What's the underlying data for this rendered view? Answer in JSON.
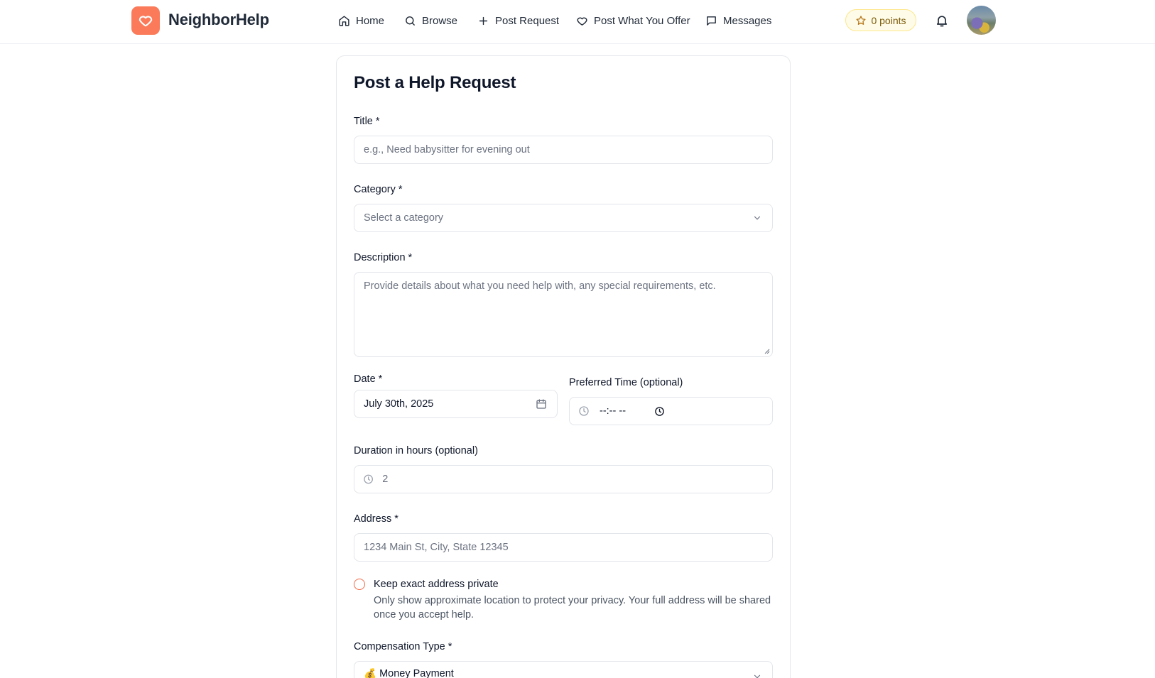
{
  "brand": {
    "name": "NeighborHelp",
    "icon": "heart-icon",
    "color": "#fb7a59"
  },
  "nav": {
    "home": "Home",
    "browse": "Browse",
    "post_request": "Post Request",
    "post_offer": "Post What You Offer",
    "messages": "Messages"
  },
  "header": {
    "points_label": "0 points"
  },
  "form": {
    "heading": "Post a Help Request",
    "title_label": "Title *",
    "title_placeholder": "e.g., Need babysitter for evening out",
    "category_label": "Category *",
    "category_placeholder": "Select a category",
    "description_label": "Description *",
    "description_placeholder": "Provide details about what you need help with, any special requirements, etc.",
    "date_label": "Date *",
    "date_value": "July 30th, 2025",
    "time_label": "Preferred Time (optional)",
    "time_value": "--:-- --",
    "duration_label": "Duration in hours (optional)",
    "duration_placeholder": "2",
    "address_label": "Address *",
    "address_placeholder": "1234 Main St, City, State 12345",
    "private_label": "Keep exact address private",
    "private_help": "Only show approximate location to protect your privacy. Your full address will be shared once you accept help.",
    "compensation_label": "Compensation Type *",
    "compensation_emoji": "💰",
    "compensation_value": "Money Payment"
  },
  "colors": {
    "accent": "#f26a47",
    "points_bg": "#fefce8",
    "points_border": "#fde68a"
  }
}
